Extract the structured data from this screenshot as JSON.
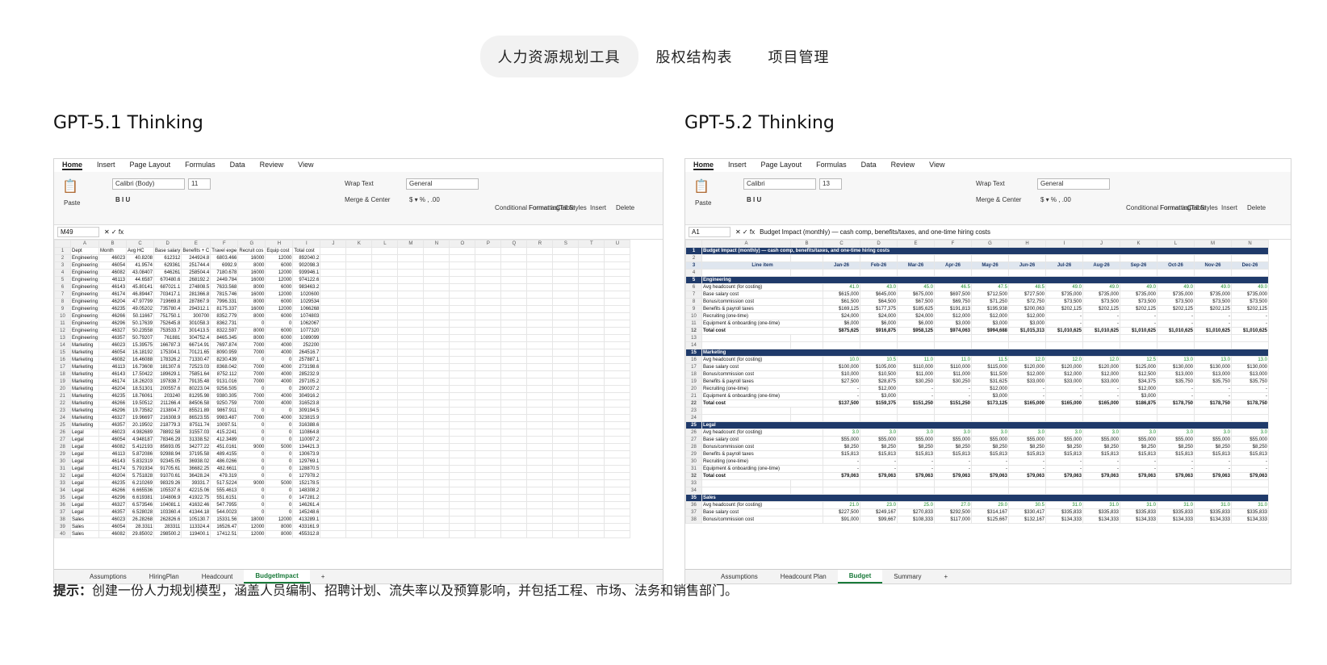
{
  "tabs": [
    "人力资源规划工具",
    "股权结构表",
    "项目管理"
  ],
  "left": {
    "title": "GPT-5.1 Thinking",
    "menu": [
      "Home",
      "Insert",
      "Page Layout",
      "Formulas",
      "Data",
      "Review",
      "View"
    ],
    "paste": "Paste",
    "font": "Calibri (Body)",
    "size": "11",
    "wrap": "Wrap Text",
    "merge": "Merge & Center",
    "format": "General",
    "cond": "Conditional Formatting",
    "fmt_table": "Format as Table",
    "cell_styles": "Cell Styles",
    "insert": "Insert",
    "delete": "Delete",
    "namebox": "M49",
    "formula": "",
    "cols": [
      "A",
      "B",
      "C",
      "D",
      "E",
      "F",
      "G",
      "H",
      "I",
      "J",
      "K",
      "L",
      "M",
      "N",
      "O",
      "P",
      "Q",
      "R",
      "S",
      "T",
      "U"
    ],
    "rows": [
      [
        "Dept",
        "Month",
        "Avg HC",
        "Base salary",
        "Benefits + C",
        "Travel expe",
        "Recruit cos",
        "Equip cost",
        "Total cost"
      ],
      [
        "Engineering",
        "46023",
        "40.8208",
        "612312",
        "244924.8",
        "6803.466",
        "16000",
        "12000",
        "892040.2"
      ],
      [
        "Engineering",
        "46054",
        "41.9574",
        "629361",
        "251744.4",
        "6992.9",
        "8000",
        "6000",
        "902098.3"
      ],
      [
        "Engineering",
        "46082",
        "43.08407",
        "646261",
        "258504.4",
        "7180.678",
        "16000",
        "12000",
        "939946.1"
      ],
      [
        "Engineering",
        "46113",
        "44.6587",
        "670480.6",
        "268192.2",
        "2449.784",
        "16000",
        "12000",
        "974122.6"
      ],
      [
        "Engineering",
        "46143",
        "45.80141",
        "687021.1",
        "274808.5",
        "7633.568",
        "8000",
        "6000",
        "983463.2"
      ],
      [
        "Engineering",
        "46174",
        "46.89447",
        "703417.1",
        "281366.8",
        "7815.746",
        "16000",
        "12000",
        "1020600"
      ],
      [
        "Engineering",
        "46204",
        "47.97799",
        "719669.8",
        "287867.9",
        "7996.331",
        "8000",
        "6000",
        "1029534"
      ],
      [
        "Engineering",
        "46235",
        "49.05202",
        "735780.4",
        "294312.1",
        "8175.337",
        "16000",
        "12000",
        "1066268"
      ],
      [
        "Engineering",
        "46266",
        "50.11667",
        "751750.1",
        "300700",
        "8352.779",
        "8000",
        "6000",
        "1074803"
      ],
      [
        "Engineering",
        "46296",
        "50.17639",
        "752645.8",
        "301058.3",
        "8362.731",
        "0",
        "0",
        "1062067"
      ],
      [
        "Engineering",
        "46327",
        "50.23558",
        "753533.7",
        "301413.5",
        "8322.597",
        "8000",
        "6000",
        "1077320"
      ],
      [
        "Engineering",
        "46357",
        "50.79207",
        "761881",
        "304752.4",
        "8465.345",
        "8000",
        "6000",
        "1089099"
      ],
      [
        "Marketing",
        "46023",
        "15.39575",
        "166787.3",
        "66714.91",
        "7697.874",
        "7000",
        "4000",
        "252200"
      ],
      [
        "Marketing",
        "46054",
        "16.18192",
        "175304.1",
        "70121.65",
        "8090.959",
        "7000",
        "4000",
        "264516.7"
      ],
      [
        "Marketing",
        "46082",
        "16.46088",
        "178326.2",
        "71330.47",
        "8230.439",
        "0",
        "0",
        "257887.1"
      ],
      [
        "Marketing",
        "46113",
        "16.73608",
        "181307.6",
        "72523.03",
        "8368.042",
        "7000",
        "4000",
        "273198.6"
      ],
      [
        "Marketing",
        "46143",
        "17.50422",
        "189629.1",
        "75851.64",
        "8752.112",
        "7000",
        "4000",
        "285232.9"
      ],
      [
        "Marketing",
        "46174",
        "18.26203",
        "197838.7",
        "79135.48",
        "9131.016",
        "7000",
        "4000",
        "297105.2"
      ],
      [
        "Marketing",
        "46204",
        "18.51301",
        "200557.6",
        "80223.04",
        "9256.505",
        "0",
        "0",
        "290037.2"
      ],
      [
        "Marketing",
        "46235",
        "18.76061",
        "203240",
        "81295.98",
        "9380.305",
        "7000",
        "4000",
        "304916.2"
      ],
      [
        "Marketing",
        "46266",
        "19.50512",
        "211266.4",
        "84506.58",
        "9250.759",
        "7000",
        "4000",
        "316523.8"
      ],
      [
        "Marketing",
        "46296",
        "19.73582",
        "213804.7",
        "85521.89",
        "9867.911",
        "0",
        "0",
        "309194.5"
      ],
      [
        "Marketing",
        "46327",
        "19.96697",
        "216308.9",
        "86523.55",
        "9983.487",
        "7000",
        "4000",
        "323815.9"
      ],
      [
        "Marketing",
        "46357",
        "20.19502",
        "218779.3",
        "87511.74",
        "10097.51",
        "0",
        "0",
        "316388.6"
      ],
      [
        "Legal",
        "46023",
        "4.982689",
        "78892.58",
        "31557.03",
        "415.2241",
        "0",
        "0",
        "110864.8"
      ],
      [
        "Legal",
        "46054",
        "4.948187",
        "78346.29",
        "31338.52",
        "412.3489",
        "0",
        "0",
        "110097.2"
      ],
      [
        "Legal",
        "46082",
        "5.412193",
        "85693.05",
        "34277.22",
        "451.0161",
        "9000",
        "5000",
        "134421.3"
      ],
      [
        "Legal",
        "46113",
        "5.872086",
        "92988.94",
        "37195.58",
        "489.4155",
        "0",
        "0",
        "130673.9"
      ],
      [
        "Legal",
        "46143",
        "5.832319",
        "92345.05",
        "36938.02",
        "486.0266",
        "0",
        "0",
        "129769.1"
      ],
      [
        "Legal",
        "46174",
        "5.791934",
        "91705.61",
        "36682.25",
        "482.6611",
        "0",
        "0",
        "128870.5"
      ],
      [
        "Legal",
        "46204",
        "5.751828",
        "91070.61",
        "36428.24",
        "479.319",
        "0",
        "0",
        "127978.2"
      ],
      [
        "Legal",
        "46235",
        "6.210269",
        "98329.26",
        "39331.7",
        "517.5224",
        "9000",
        "5000",
        "152178.5"
      ],
      [
        "Legal",
        "46266",
        "6.665536",
        "105537.6",
        "42215.06",
        "555.4613",
        "0",
        "0",
        "148308.2"
      ],
      [
        "Legal",
        "46296",
        "6.619381",
        "104806.9",
        "41922.75",
        "551.6151",
        "0",
        "0",
        "147281.2"
      ],
      [
        "Legal",
        "46327",
        "6.573546",
        "104081.1",
        "41632.46",
        "547.7955",
        "0",
        "0",
        "146261.4"
      ],
      [
        "Legal",
        "46357",
        "6.528028",
        "103360.4",
        "41344.18",
        "544.0023",
        "0",
        "0",
        "145248.6"
      ],
      [
        "Sales",
        "46023",
        "26.28268",
        "262826.6",
        "105130.7",
        "15331.56",
        "18000",
        "12000",
        "413289.1"
      ],
      [
        "Sales",
        "46054",
        "28.3311",
        "283311",
        "113324.4",
        "16526.47",
        "12000",
        "8000",
        "433161.9"
      ],
      [
        "Sales",
        "46082",
        "29.85002",
        "298500.2",
        "119400.1",
        "17412.51",
        "12000",
        "8000",
        "455312.8"
      ]
    ],
    "sheets": [
      "Assumptions",
      "HiringPlan",
      "Headcount",
      "BudgetImpact"
    ],
    "active_sheet": "BudgetImpact"
  },
  "right": {
    "title": "GPT-5.2 Thinking",
    "menu": [
      "Home",
      "Insert",
      "Page Layout",
      "Formulas",
      "Data",
      "Review",
      "View"
    ],
    "paste": "Paste",
    "font": "Calibri",
    "size": "13",
    "wrap": "Wrap Text",
    "merge": "Merge & Center",
    "format": "General",
    "cond": "Conditional Formatting",
    "fmt_table": "Format as Table",
    "cell_styles": "Cell Styles",
    "insert": "Insert",
    "delete": "Delete",
    "namebox": "A1",
    "formula": "Budget Impact (monthly) — cash comp, benefits/taxes, and one-time hiring costs",
    "cols": [
      "A",
      "B",
      "C",
      "D",
      "E",
      "F",
      "G",
      "H",
      "I",
      "J",
      "K",
      "L",
      "M",
      "N"
    ],
    "sheet_title": "Budget Impact (monthly) — cash comp, benefits/taxes, and one-time hiring costs",
    "line_item": "Line item",
    "months": [
      "Jan-26",
      "Feb-26",
      "Mar-26",
      "Apr-26",
      "May-26",
      "Jun-26",
      "Jul-26",
      "Aug-26",
      "Sep-26",
      "Oct-26",
      "Nov-26",
      "Dec-26"
    ],
    "blocks": [
      {
        "name": "Engineering",
        "rows": [
          [
            "Avg headcount (for costing)",
            "41.0",
            "43.0",
            "45.0",
            "46.5",
            "47.5",
            "48.5",
            "49.0",
            "49.0",
            "49.0",
            "49.0",
            "49.0",
            "49.0"
          ],
          [
            "Base salary cost",
            "$615,000",
            "$645,000",
            "$675,000",
            "$697,500",
            "$712,500",
            "$727,500",
            "$735,000",
            "$735,000",
            "$735,000",
            "$735,000",
            "$735,000",
            "$735,000"
          ],
          [
            "Bonus/commission cost",
            "$61,500",
            "$64,500",
            "$67,500",
            "$69,750",
            "$71,250",
            "$72,750",
            "$73,500",
            "$73,500",
            "$73,500",
            "$73,500",
            "$73,500",
            "$73,500"
          ],
          [
            "Benefits & payroll taxes",
            "$169,125",
            "$177,375",
            "$185,625",
            "$191,813",
            "$195,938",
            "$200,063",
            "$202,125",
            "$202,125",
            "$202,125",
            "$202,125",
            "$202,125",
            "$202,125"
          ],
          [
            "Recruiting (one-time)",
            "$24,000",
            "$24,000",
            "$24,000",
            "$12,000",
            "$12,000",
            "$12,000",
            "-",
            "-",
            "-",
            "-",
            "-",
            "-"
          ],
          [
            "Equipment & onboarding (one-time)",
            "$6,000",
            "$6,000",
            "$6,000",
            "$3,000",
            "$3,000",
            "$3,000",
            "-",
            "-",
            "-",
            "-",
            "-",
            "-"
          ],
          [
            "Total cost",
            "$875,625",
            "$916,875",
            "$958,125",
            "$974,063",
            "$994,688",
            "$1,015,313",
            "$1,010,625",
            "$1,010,625",
            "$1,010,625",
            "$1,010,625",
            "$1,010,625",
            "$1,010,625"
          ]
        ]
      },
      {
        "name": "Marketing",
        "rows": [
          [
            "Avg headcount (for costing)",
            "10.0",
            "10.5",
            "11.0",
            "11.0",
            "11.5",
            "12.0",
            "12.0",
            "12.0",
            "12.5",
            "13.0",
            "13.0",
            "13.0"
          ],
          [
            "Base salary cost",
            "$100,000",
            "$105,000",
            "$110,000",
            "$110,000",
            "$115,000",
            "$120,000",
            "$120,000",
            "$120,000",
            "$125,000",
            "$130,000",
            "$130,000",
            "$130,000"
          ],
          [
            "Bonus/commission cost",
            "$10,000",
            "$10,500",
            "$11,000",
            "$11,000",
            "$11,500",
            "$12,000",
            "$12,000",
            "$12,000",
            "$12,500",
            "$13,000",
            "$13,000",
            "$13,000"
          ],
          [
            "Benefits & payroll taxes",
            "$27,500",
            "$28,875",
            "$30,250",
            "$30,250",
            "$31,625",
            "$33,000",
            "$33,000",
            "$33,000",
            "$34,375",
            "$35,750",
            "$35,750",
            "$35,750"
          ],
          [
            "Recruiting (one-time)",
            "-",
            "$12,000",
            "-",
            "-",
            "$12,000",
            "-",
            "-",
            "-",
            "$12,000",
            "-",
            "-",
            "-"
          ],
          [
            "Equipment & onboarding (one-time)",
            "-",
            "$3,000",
            "-",
            "-",
            "$3,000",
            "-",
            "-",
            "-",
            "$3,000",
            "-",
            "-",
            "-"
          ],
          [
            "Total cost",
            "$137,500",
            "$159,375",
            "$151,250",
            "$151,250",
            "$173,125",
            "$165,000",
            "$165,000",
            "$165,000",
            "$186,875",
            "$178,750",
            "$178,750",
            "$178,750"
          ]
        ]
      },
      {
        "name": "Legal",
        "rows": [
          [
            "Avg headcount (for costing)",
            "3.0",
            "3.0",
            "3.0",
            "3.0",
            "3.0",
            "3.0",
            "3.0",
            "3.0",
            "3.0",
            "3.0",
            "3.0",
            "3.0"
          ],
          [
            "Base salary cost",
            "$55,000",
            "$55,000",
            "$55,000",
            "$55,000",
            "$55,000",
            "$55,000",
            "$55,000",
            "$55,000",
            "$55,000",
            "$55,000",
            "$55,000",
            "$55,000"
          ],
          [
            "Bonus/commission cost",
            "$8,250",
            "$8,250",
            "$8,250",
            "$8,250",
            "$8,250",
            "$8,250",
            "$8,250",
            "$8,250",
            "$8,250",
            "$8,250",
            "$8,250",
            "$8,250"
          ],
          [
            "Benefits & payroll taxes",
            "$15,813",
            "$15,813",
            "$15,813",
            "$15,813",
            "$15,813",
            "$15,813",
            "$15,813",
            "$15,813",
            "$15,813",
            "$15,813",
            "$15,813",
            "$15,813"
          ],
          [
            "Recruiting (one-time)",
            "-",
            "-",
            "-",
            "-",
            "-",
            "-",
            "-",
            "-",
            "-",
            "-",
            "-",
            "-"
          ],
          [
            "Equipment & onboarding (one-time)",
            "-",
            "-",
            "-",
            "-",
            "-",
            "-",
            "-",
            "-",
            "-",
            "-",
            "-",
            "-"
          ],
          [
            "Total cost",
            "$79,063",
            "$79,063",
            "$79,063",
            "$79,063",
            "$79,063",
            "$79,063",
            "$79,063",
            "$79,063",
            "$79,063",
            "$79,063",
            "$79,063",
            "$79,063"
          ]
        ]
      },
      {
        "name": "Sales",
        "rows": [
          [
            "Avg headcount (for costing)",
            "21.0",
            "23.0",
            "25.0",
            "27.0",
            "29.0",
            "30.5",
            "31.0",
            "31.0",
            "31.0",
            "31.0",
            "31.0",
            "31.0"
          ],
          [
            "Base salary cost",
            "$227,500",
            "$249,167",
            "$270,833",
            "$292,500",
            "$314,167",
            "$330,417",
            "$335,833",
            "$335,833",
            "$335,833",
            "$335,833",
            "$335,833",
            "$335,833"
          ],
          [
            "Bonus/commission cost",
            "$91,000",
            "$99,667",
            "$108,333",
            "$117,000",
            "$125,667",
            "$132,167",
            "$134,333",
            "$134,333",
            "$134,333",
            "$134,333",
            "$134,333",
            "$134,333"
          ]
        ]
      }
    ],
    "sheets": [
      "Assumptions",
      "Headcount Plan",
      "Budget",
      "Summary"
    ],
    "active_sheet": "Budget"
  },
  "prompt_label": "提示：",
  "prompt_text": "创建一份人力规划模型，涵盖人员编制、招聘计划、流失率以及预算影响，并包括工程、市场、法务和销售部门。"
}
